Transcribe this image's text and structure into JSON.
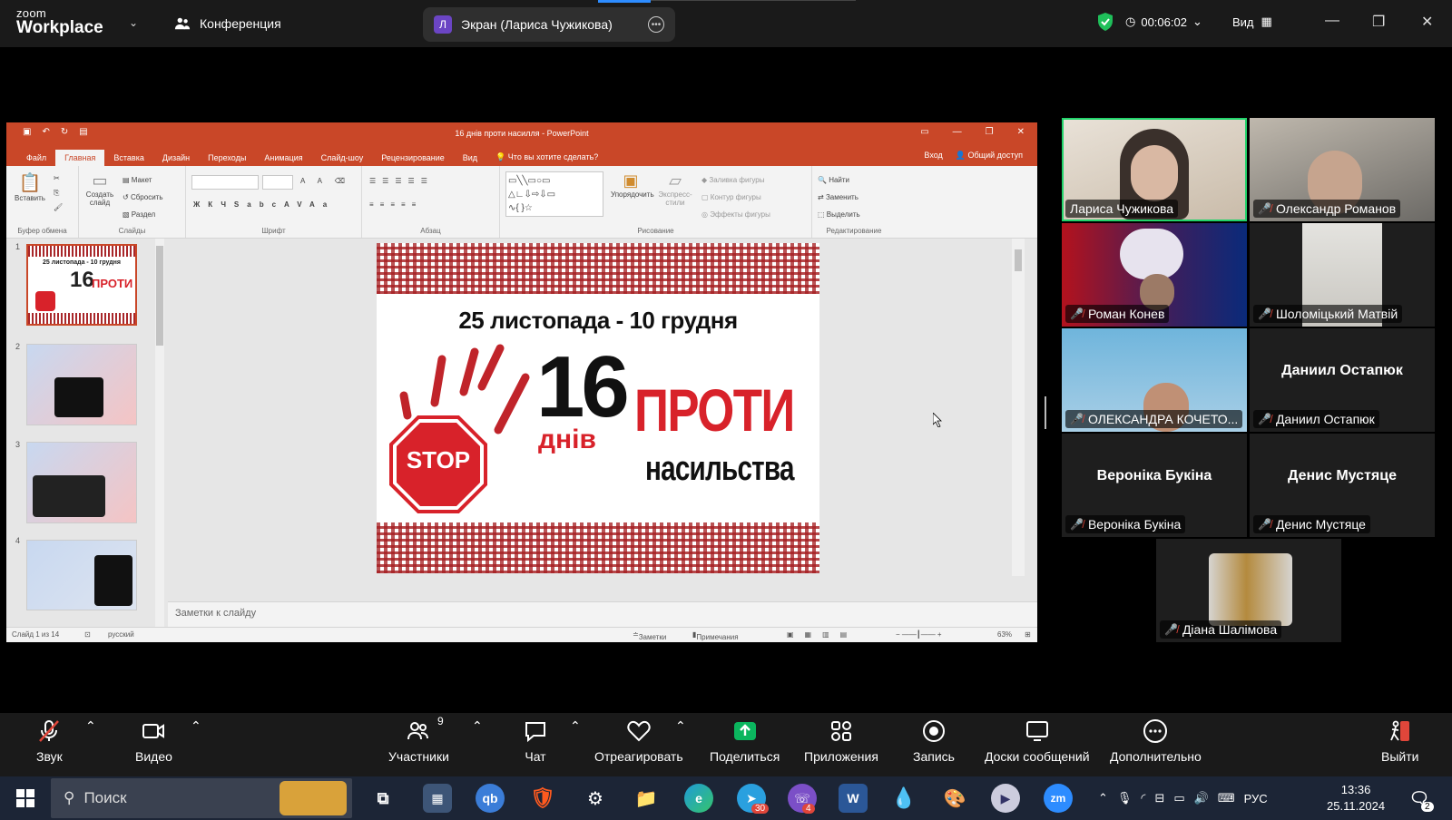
{
  "zoom": {
    "logo_top": "zoom",
    "logo_bottom": "Workplace",
    "conference_label": "Конференция",
    "screen_avatar_letter": "Л",
    "screen_label": "Экран (Лариса Чужикова)",
    "timer": "00:06:02",
    "view_label": "Вид"
  },
  "ppt": {
    "title": "16 днів проти насилля - PowerPoint",
    "tabs": [
      "Файл",
      "Главная",
      "Вставка",
      "Дизайн",
      "Переходы",
      "Анимация",
      "Слайд-шоу",
      "Рецензирование",
      "Вид",
      "Что вы хотите сделать?"
    ],
    "signin": "Вход",
    "share": "Общий доступ",
    "groups": {
      "clipboard": "Буфер обмена",
      "slides": "Слайды",
      "font": "Шрифт",
      "paragraph": "Абзац",
      "drawing": "Рисование",
      "editing": "Редактирование"
    },
    "ribbon_buttons": {
      "paste": "Вставить",
      "create_slide": "Создать слайд",
      "layout": "Макет",
      "reset": "Сбросить",
      "section": "Раздел",
      "arrange": "Упорядочить",
      "quick_styles": "Экспресс-стили",
      "shape_fill": "Заливка фигуры",
      "shape_outline": "Контур фигуры",
      "shape_effects": "Эффекты фигуры",
      "find": "Найти",
      "replace": "Заменить",
      "select": "Выделить"
    },
    "slide_numbers": [
      "1",
      "2",
      "3",
      "4"
    ],
    "slide": {
      "dates": "25 листопада - 10 грудня",
      "number": "16",
      "days": "днів",
      "against": "ПРОТИ",
      "violence": "насильства",
      "stop": "STOP"
    },
    "notes_placeholder": "Заметки к слайду",
    "status": {
      "slide_count": "Слайд 1 из 14",
      "language": "русский",
      "notes": "Заметки",
      "comments": "Примечания",
      "zoom": "63%"
    }
  },
  "participants": [
    {
      "name": "Лариса Чужикова",
      "muted": false,
      "video": true,
      "speaking": true
    },
    {
      "name": "Олександр Романов",
      "muted": true,
      "video": true
    },
    {
      "name": "Роман Конев",
      "muted": true,
      "video": true
    },
    {
      "name": "Шоломіцький Матвій",
      "muted": true,
      "video": true
    },
    {
      "name": "ОЛЕКСАНДРА КОЧЕТО...",
      "muted": true,
      "video": true
    },
    {
      "name": "Даниил Остапюк",
      "muted": true,
      "video": false,
      "display": "Даниил Остапюк"
    },
    {
      "name": "Вероніка Букіна",
      "muted": true,
      "video": false,
      "display": "Вероніка Букіна"
    },
    {
      "name": "Денис Мустяце",
      "muted": true,
      "video": false,
      "display": "Денис Мустяце"
    },
    {
      "name": "Діана Шалімова",
      "muted": true,
      "video": true
    }
  ],
  "toolbar": {
    "audio": "Звук",
    "video": "Видео",
    "participants": "Участники",
    "participants_count": "9",
    "chat": "Чат",
    "react": "Отреагировать",
    "share": "Поделиться",
    "apps": "Приложения",
    "record": "Запись",
    "whiteboards": "Доски сообщений",
    "more": "Дополнительно",
    "leave": "Выйти"
  },
  "taskbar": {
    "search_placeholder": "Поиск",
    "lang": "РУС",
    "time": "13:36",
    "date": "25.11.2024",
    "telegram_badge": "30",
    "viber_badge": "4",
    "notif_badge": "2"
  },
  "colors": {
    "ppt_accent": "#c94728",
    "zoom_bg": "#1a1a1a",
    "speaking": "#22d36b",
    "muted": "#e0463a",
    "share_green": "#0bb55e"
  }
}
